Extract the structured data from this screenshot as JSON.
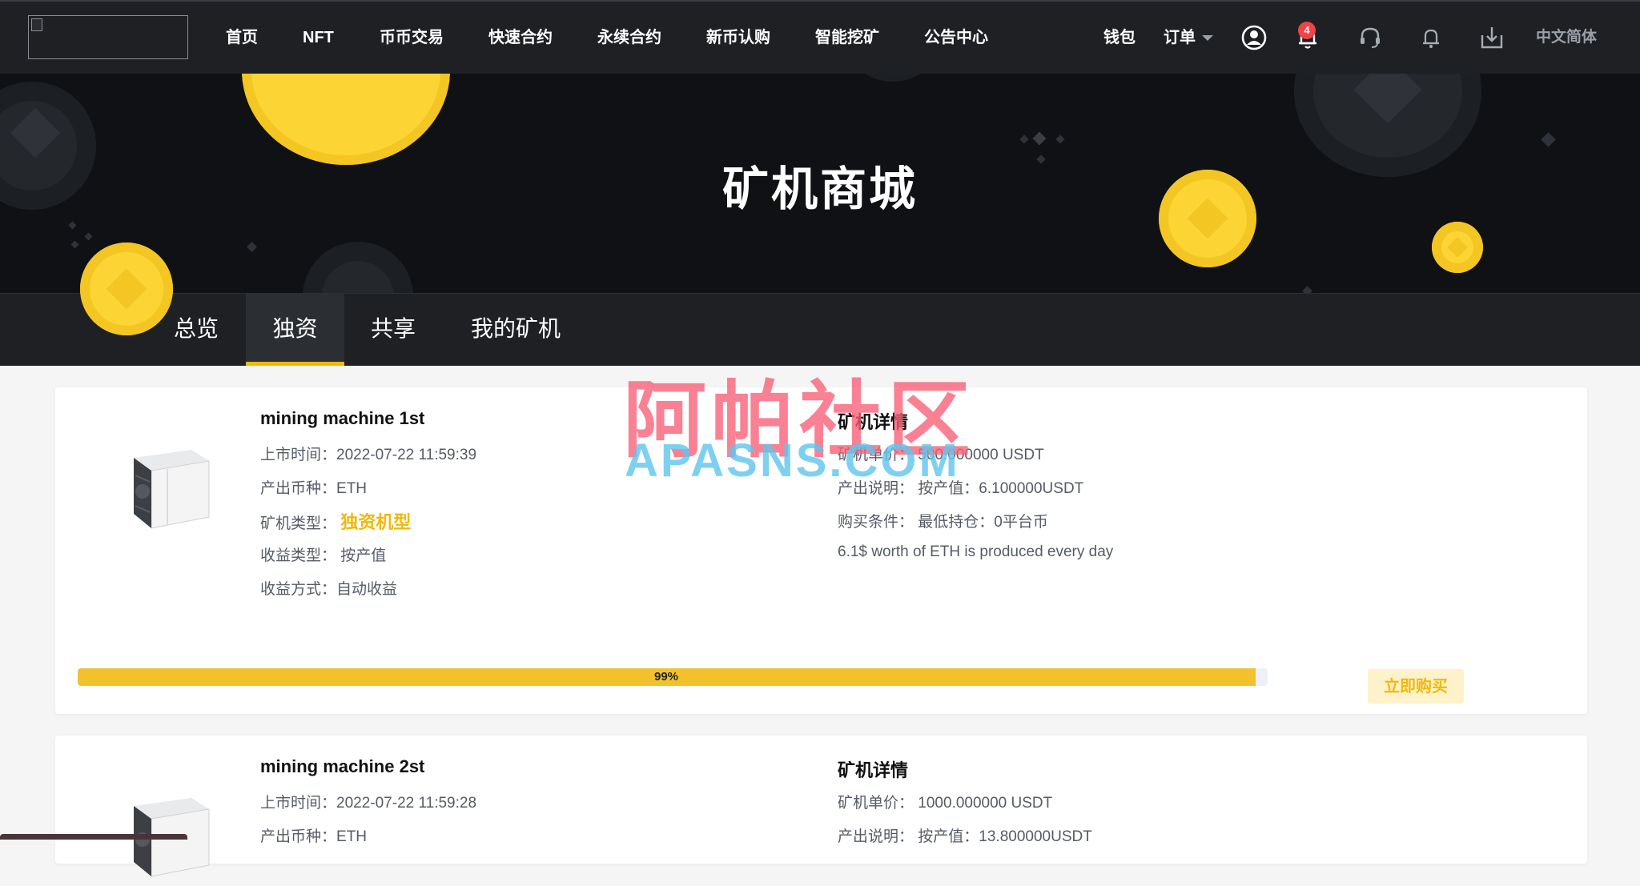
{
  "nav": {
    "items": [
      {
        "label": "首页"
      },
      {
        "label": "NFT"
      },
      {
        "label": "币币交易"
      },
      {
        "label": "快速合约"
      },
      {
        "label": "永续合约"
      },
      {
        "label": "新币认购"
      },
      {
        "label": "智能挖矿"
      },
      {
        "label": "公告中心"
      }
    ],
    "wallet": "钱包",
    "orders": "订单",
    "notification_count": "4",
    "language": "中文简体",
    "icons": [
      "user-icon",
      "bell-icon",
      "headset-icon",
      "alarm-icon",
      "download-icon"
    ]
  },
  "hero": {
    "title": "矿机商城"
  },
  "tabs": [
    {
      "label": "总览",
      "active": false
    },
    {
      "label": "独资",
      "active": true
    },
    {
      "label": "共享",
      "active": false
    },
    {
      "label": "我的矿机",
      "active": false
    }
  ],
  "labels": {
    "listed_time": "上市时间：",
    "output_coin": "产出币种：",
    "machine_type": "矿机类型：",
    "income_type": "收益类型：",
    "income_method": "收益方式：",
    "details": "矿机详情",
    "unit_price": "矿机单价：",
    "output_desc": "产出说明：",
    "buy_condition": "购买条件：",
    "buy_button": "立即购买"
  },
  "machines": [
    {
      "title": "mining machine 1st",
      "listed_time": "2022-07-22 11:59:39",
      "output_coin": "ETH",
      "machine_type": "独资机型",
      "income_type": "按产值",
      "income_method": "自动收益",
      "unit_price": "500.000000 USDT",
      "output_desc": "按产值：6.100000USDT",
      "buy_condition": "最低持仓：0平台币",
      "note": "6.1$ worth of ETH is produced every day",
      "progress": 0.99,
      "progress_label": "99%"
    },
    {
      "title": "mining machine 2st",
      "listed_time": "2022-07-22 11:59:28",
      "output_coin": "ETH",
      "unit_price": "1000.000000 USDT",
      "output_desc": "按产值：13.800000USDT"
    }
  ],
  "watermark": {
    "cn": "阿帕社区",
    "en": "APASNS.COM"
  },
  "colors": {
    "accent": "#f0b90b",
    "nav_bg": "#1e2024",
    "hero_bg": "#0f1114",
    "badge": "#f0434a"
  }
}
